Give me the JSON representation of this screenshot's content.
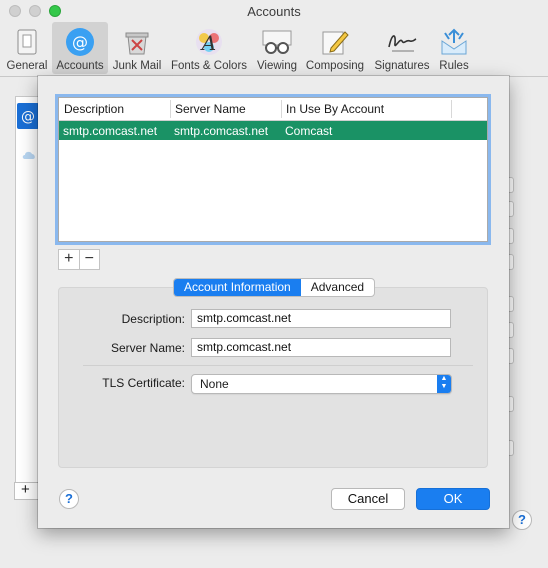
{
  "window": {
    "title": "Accounts"
  },
  "toolbar": {
    "items": [
      {
        "label": "General",
        "icon": "general-icon",
        "active": false
      },
      {
        "label": "Accounts",
        "icon": "at-sign-icon",
        "active": true
      },
      {
        "label": "Junk Mail",
        "icon": "junk-mail-icon",
        "active": false
      },
      {
        "label": "Fonts & Colors",
        "icon": "fonts-colors-icon",
        "active": false
      },
      {
        "label": "Viewing",
        "icon": "glasses-icon",
        "active": false
      },
      {
        "label": "Composing",
        "icon": "compose-pencil-icon",
        "active": false
      },
      {
        "label": "Signatures",
        "icon": "signature-icon",
        "active": false
      },
      {
        "label": "Rules",
        "icon": "rules-envelope-icon",
        "active": false
      }
    ]
  },
  "smtp_table": {
    "columns": [
      "Description",
      "Server Name",
      "In Use By Account"
    ],
    "rows": [
      {
        "description": "smtp.comcast.net",
        "server_name": "smtp.comcast.net",
        "in_use_by": "Comcast",
        "selected": true
      }
    ],
    "add_symbol": "+",
    "remove_symbol": "−"
  },
  "tabs": [
    {
      "label": "Account Information",
      "selected": true
    },
    {
      "label": "Advanced",
      "selected": false
    }
  ],
  "form": {
    "description_label": "Description:",
    "description_value": "smtp.comcast.net",
    "server_name_label": "Server Name:",
    "server_name_value": "smtp.comcast.net",
    "tls_label": "TLS Certificate:",
    "tls_value": "None"
  },
  "buttons": {
    "help": "?",
    "cancel": "Cancel",
    "ok": "OK"
  },
  "background": {
    "add_symbol": "+",
    "help": "?"
  },
  "colors": {
    "selection": "#1a9265",
    "accent": "#1a7ef0",
    "close": "#d0d0d0",
    "zoom": "#34c84a"
  }
}
